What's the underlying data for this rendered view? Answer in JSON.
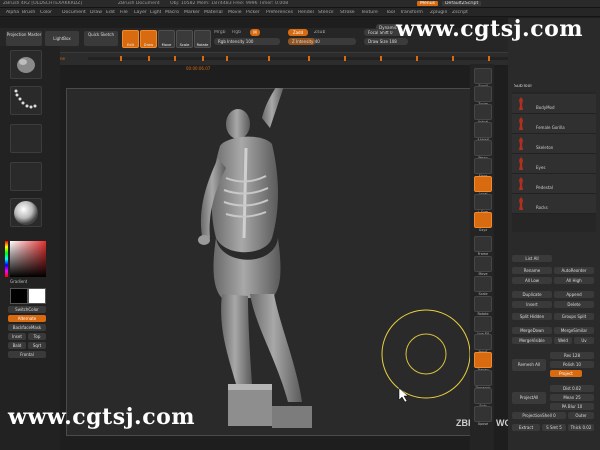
{
  "titlebar": {
    "app": "ZBrush 4R2 [OLDSCHTEXAKKRDZ]",
    "document": "ZBrush Document",
    "stats": "Obj: 10582  Mem: 1874483  Free: 9996  Timer: 0.008",
    "menus_btn": "Menus",
    "script_btn": "DefaultZScript",
    "help_btn": "?"
  },
  "menubar": {
    "items": [
      "Alpha",
      "Brush",
      "Color",
      "Document",
      "Draw",
      "Edit",
      "File",
      "Layer",
      "Light",
      "Macro",
      "Marker",
      "Material",
      "Movie",
      "Picker",
      "Preferences",
      "Render",
      "Stencil",
      "Stroke",
      "Texture",
      "Tool",
      "Transform",
      "Zplugin",
      "Zscript"
    ]
  },
  "toolbar": {
    "projection_master": "Projection Master",
    "lightbox": "LightBox",
    "quick_sketch": "Quick Sketch",
    "buttons": [
      "Edit",
      "Draw",
      "Move",
      "Scale",
      "Rotate"
    ],
    "mrgb": "Mrgb",
    "rgb": "Rgb",
    "m": "M",
    "rgb_intensity": "Rgb Intensity 100",
    "zadd": "Zadd",
    "zsub": "Zsub",
    "z_intensity": "Z Intensity 40",
    "focal_shift": "Focal Shift 0",
    "draw_size": "Draw Size 108",
    "dynamic": "Dynamic"
  },
  "timeline": {
    "label": "Timeline",
    "time": "00:00:06.07"
  },
  "left_shelf": {
    "gradient": "Gradient",
    "switch_color": "SwitchColor",
    "alternate": "Alternate",
    "backface_mask": "BackfaceMask",
    "texture_off": "Texture Off",
    "matcap_red": "MatCap Red Wax",
    "inset": "Inset",
    "top": "Top",
    "bald": "Bald",
    "sqrt": "Sqrt",
    "frontal": "Frontal"
  },
  "canvas": {
    "bottom_label": "ZBRUSH WORKSHOPS",
    "cursor": "pointer"
  },
  "right_shelf": {
    "buttons": [
      "Scroll",
      "Zoom",
      "Actual",
      "AAHalf",
      "Persp",
      "Floor",
      "Local",
      "L.Sym",
      "Gxyz",
      "Frame",
      "Move",
      "Scale",
      "Rotate",
      "Line Fill",
      "PolyF",
      "Transp",
      "Dynamic",
      "Solo",
      "Xpose"
    ]
  },
  "right_panel": {
    "subtool_header": "SubTool",
    "subtools": [
      "BodyMod",
      "Female Gorilla",
      "Skeleton",
      "Eyes",
      "Pedestal",
      "Rocks"
    ],
    "list_all": "List All",
    "rename": "Rename",
    "auto_reorder": "AutoReorder",
    "all_low": "All Low",
    "all_high": "All High",
    "duplicate": "Duplicate",
    "append": "Append",
    "insert": "Insert",
    "delete": "Delete",
    "split_hidden": "Split Hidden",
    "group_split": "Groups Split",
    "merge_down": "MergeDown",
    "merge_similar": "MergeSimilar",
    "merge_visible": "MergeVisible",
    "weld": "Weld",
    "uv": "Uv",
    "remesh_all": "Remesh All",
    "res": "Res 128",
    "polish": "Polish 10",
    "project_all": "ProjectAll",
    "project": "Project",
    "dist": "Dist 0.02",
    "mean": "Mean 25",
    "pa_blur": "PA Blur 10",
    "projection_shell": "ProjectionShell 0",
    "inner": "Inner",
    "outer": "Outer",
    "extract": "Extract",
    "s_smt": "S Smt 5",
    "thick": "Thick 0.02"
  },
  "watermarks": {
    "top": "www.cgtsj.com",
    "bottom": "www.cgtsj.com"
  },
  "colors": {
    "accent": "#d86a10",
    "background": "#1e1e1e",
    "canvas": "#2a2a2a",
    "primary_color": "#000000",
    "secondary_color": "#ffffff"
  }
}
